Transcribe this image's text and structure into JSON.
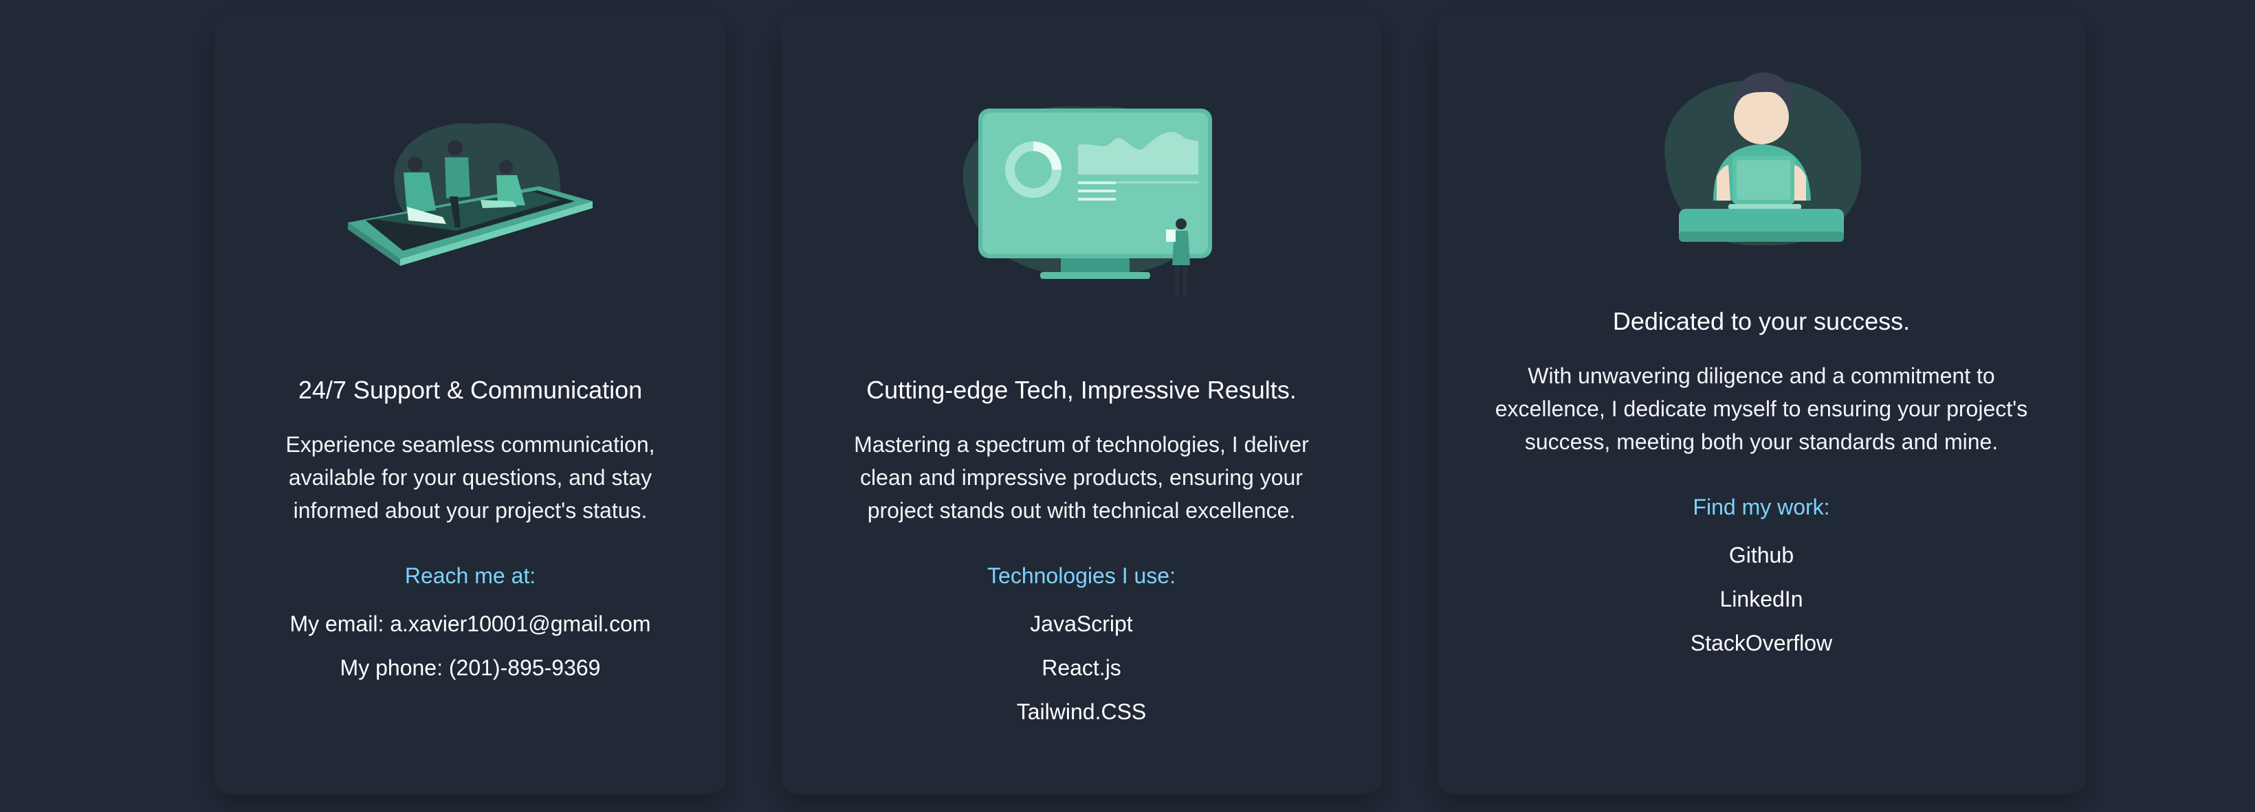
{
  "cards": [
    {
      "title": "24/7 Support & Communication",
      "description": "Experience seamless communication, available for your questions, and stay informed about your project's status.",
      "accent_label": "Reach me at:",
      "items": [
        "My email: a.xavier10001@gmail.com",
        "My phone: (201)-895-9369"
      ],
      "illustration": "team-on-phone-illustration"
    },
    {
      "title": "Cutting-edge Tech, Impressive Results.",
      "description": "Mastering a spectrum of technologies, I deliver clean and impressive products, ensuring your project stands out with technical excellence.",
      "accent_label": "Technologies I use:",
      "items": [
        "JavaScript",
        "React.js",
        "Tailwind.CSS"
      ],
      "illustration": "monitor-dashboard-illustration"
    },
    {
      "title": "Dedicated to your success.",
      "description": "With unwavering diligence and a commitment to excellence, I dedicate myself to ensuring your project's success, meeting both your standards and mine.",
      "accent_label": "Find my work:",
      "items": [
        "Github",
        "LinkedIn",
        "StackOverflow"
      ],
      "illustration": "developer-laptop-illustration"
    }
  ],
  "colors": {
    "background": "#222937",
    "card": "#212836",
    "accent": "#7dd3fc",
    "illustration_teal": "#4fb8a0"
  }
}
